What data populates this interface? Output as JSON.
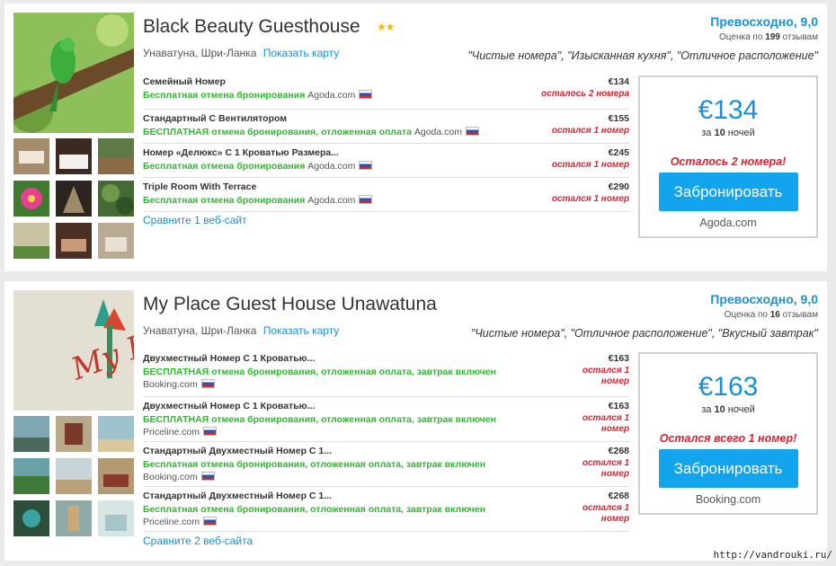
{
  "hotels": [
    {
      "name": "Black Beauty Guesthouse",
      "stars": "★★",
      "location": "Унаватуна, Шри-Ланка",
      "map_link": "Показать карту",
      "rating_label": "Превосходно, 9,0",
      "reviews_prefix": "Оценка по",
      "reviews_count": "199",
      "reviews_suffix": "отзывам",
      "quotes": "\"Чистые номера\", \"Изысканная кухня\", \"Отличное расположение\"",
      "offers": [
        {
          "title": "Семейный Номер",
          "free": "Бесплатная",
          "detail": " отмена бронирования",
          "site": "Agoda.com",
          "price": "€134",
          "left": "осталось 2 номера"
        },
        {
          "title": "Стандартный С Вентилятором",
          "free": "БЕСПЛАТНАЯ",
          "detail": " отмена бронирования, отложенная оплата",
          "site": "Agoda.com",
          "price": "€155",
          "left": "остался 1 номер"
        },
        {
          "title": "Номер «Делюкс» С 1 Кроватью Размера...",
          "free": "Бесплатная",
          "detail": " отмена бронирования",
          "site": "Agoda.com",
          "price": "€245",
          "left": "остался 1 номер"
        },
        {
          "title": "Triple Room With Terrace",
          "free": "Бесплатная",
          "detail": " отмена бронирования",
          "site": "Agoda.com",
          "price": "€290",
          "left": "остался 1 номер"
        }
      ],
      "compare": "Сравните 1 веб-сайт",
      "best_price": "€134",
      "nights_prefix": "за",
      "nights_count": "10",
      "nights_suffix": "ночей",
      "box_left": "Осталось 2 номера!",
      "book_label": "Забронировать",
      "book_site": "Agoda.com"
    },
    {
      "name": "My Place Guest House Unawatuna",
      "location": "Унаватуна, Шри-Ланка",
      "map_link": "Показать карту",
      "rating_label": "Превосходно, 9,0",
      "reviews_prefix": "Оценка по",
      "reviews_count": "16",
      "reviews_suffix": "отзывам",
      "quotes": "\"Чистые номера\", \"Отличное расположение\", \"Вкусный завтрак\"",
      "offers": [
        {
          "title": "Двухместный Номер С 1 Кроватью...",
          "free": "БЕСПЛАТНАЯ",
          "detail": " отмена бронирования, отложенная оплата, завтрак включен",
          "site": "Booking.com",
          "price": "€163",
          "left": "остался 1 номер"
        },
        {
          "title": "Двухместный Номер С 1 Кроватью...",
          "free": "БЕСПЛАТНАЯ",
          "detail": " отмена бронирования, отложенная оплата, завтрак включен",
          "site": "Priceline.com",
          "price": "€163",
          "left": "остался 1 номер"
        },
        {
          "title": "Стандартный Двухместный Номер С 1...",
          "free": "Бесплатная",
          "detail": " отмена бронирования, отложенная оплата, завтрак включен",
          "site": "Booking.com",
          "price": "€268",
          "left": "остался 1 номер"
        },
        {
          "title": "Стандартный Двухместный Номер С 1...",
          "free": "Бесплатная",
          "detail": " отмена бронирования, отложенная оплата, завтрак включен",
          "site": "Priceline.com",
          "price": "€268",
          "left": "остался 1 номер"
        }
      ],
      "compare": "Сравните 2 веб-сайта",
      "best_price": "€163",
      "nights_prefix": "за",
      "nights_count": "10",
      "nights_suffix": "ночей",
      "box_left": "Остался всего 1 номер!",
      "book_label": "Забронировать",
      "book_site": "Booking.com"
    }
  ],
  "watermark": "http://vandrouki.ru/",
  "colors": {
    "accent": "#1a8fd6",
    "button": "#13a4ee",
    "free": "#2db92d",
    "urgent": "#e0202f",
    "star": "#f5b400"
  }
}
